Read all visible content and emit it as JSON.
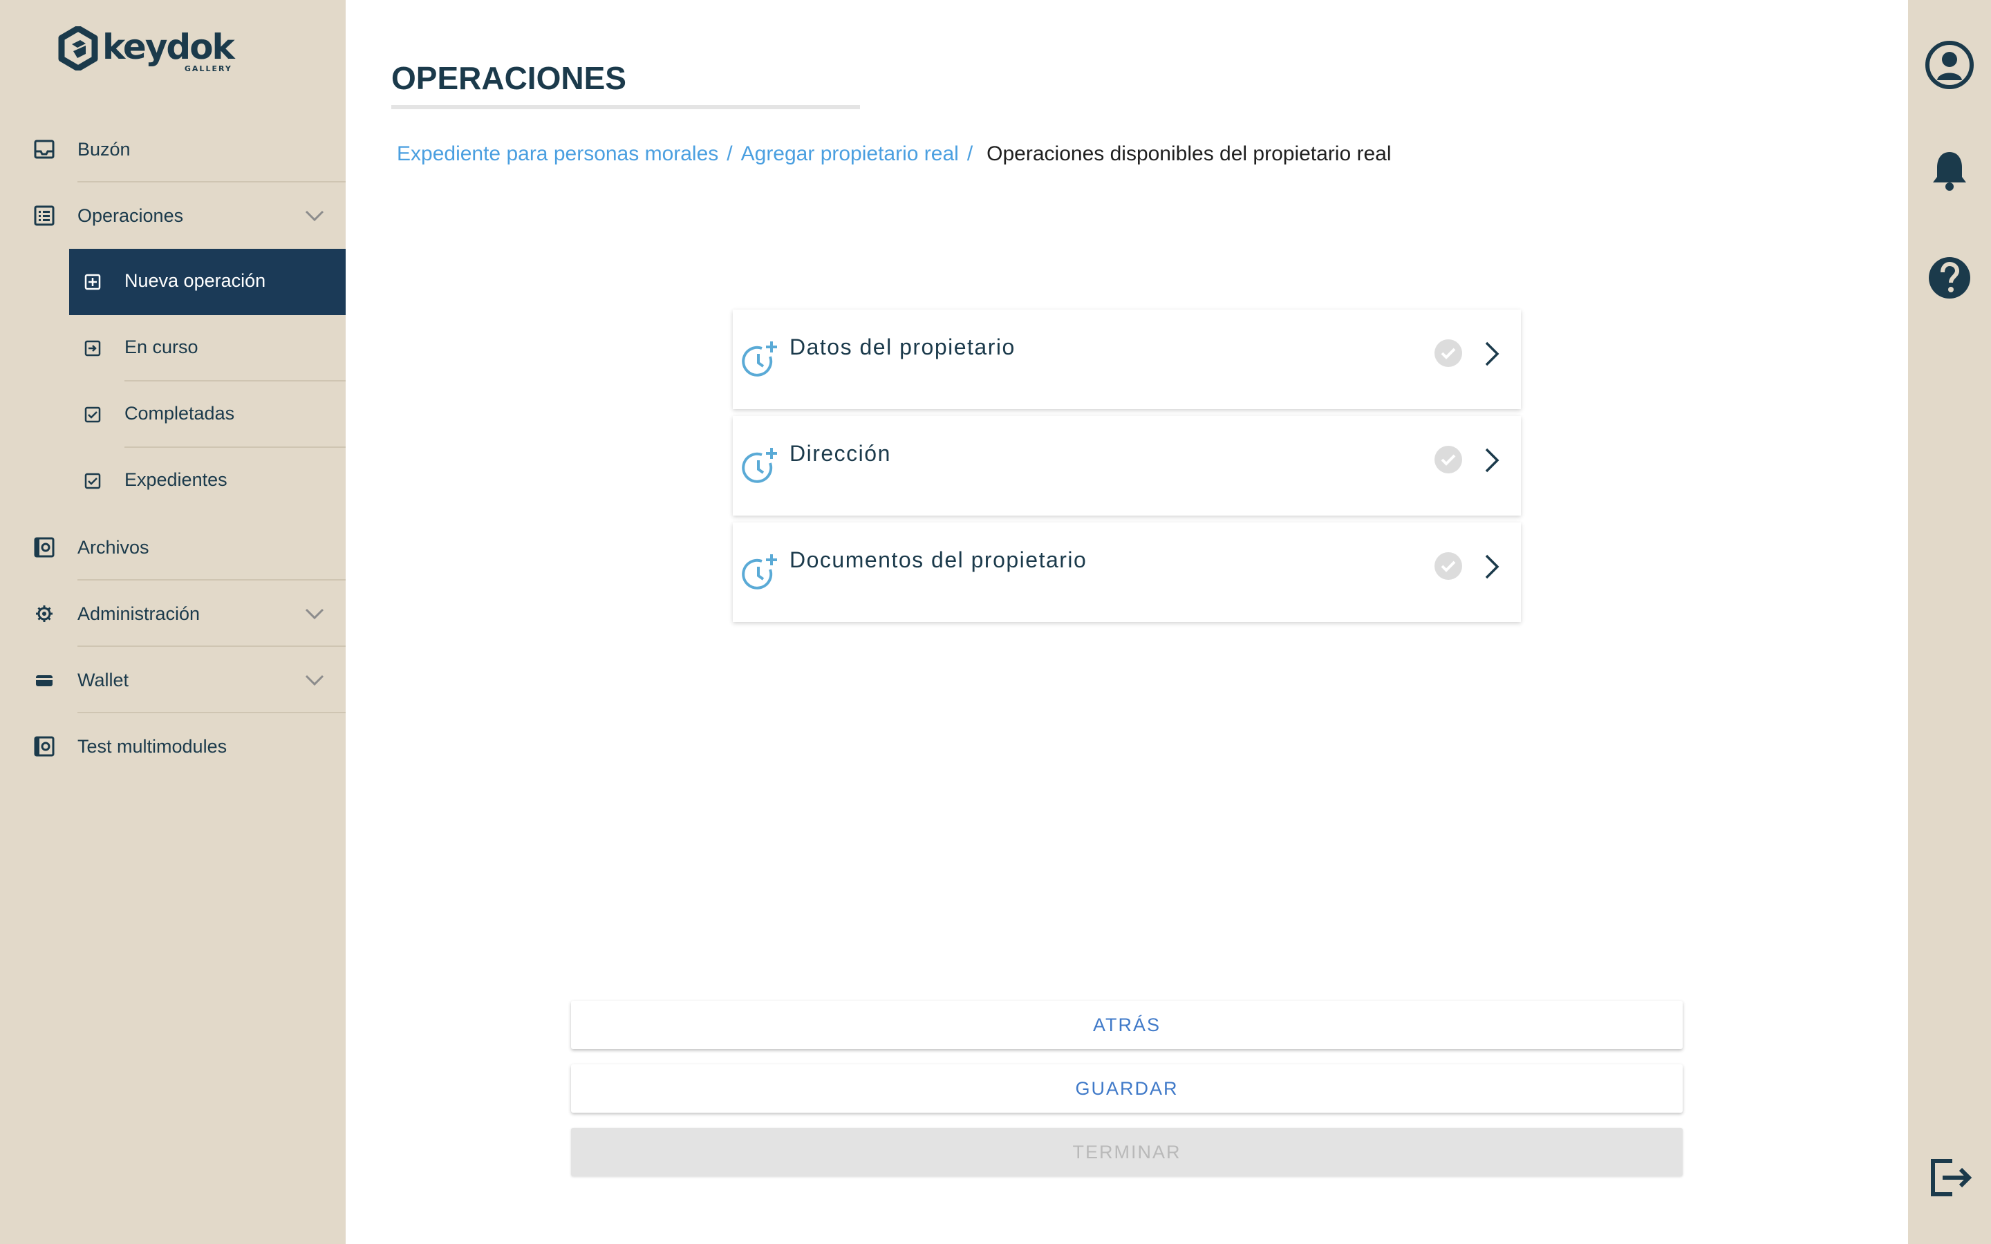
{
  "brand": {
    "logo_text": "keydok",
    "logo_sub": "GALLERY"
  },
  "sidebar": {
    "items": [
      {
        "label": "Buzón",
        "icon": "inbox-icon"
      },
      {
        "label": "Operaciones",
        "icon": "list-icon",
        "expanded": true
      },
      {
        "label": "Archivos",
        "icon": "archive-icon"
      },
      {
        "label": "Administración",
        "icon": "gear-icon"
      },
      {
        "label": "Wallet",
        "icon": "wallet-icon"
      },
      {
        "label": "Test multimodules",
        "icon": "module-icon"
      }
    ],
    "operaciones_sub": [
      {
        "label": "Nueva operación",
        "icon": "plus-box-icon",
        "active": true
      },
      {
        "label": "En curso",
        "icon": "arrow-box-icon"
      },
      {
        "label": "Completadas",
        "icon": "check-box-icon"
      },
      {
        "label": "Expedientes",
        "icon": "check-box-icon"
      }
    ]
  },
  "main": {
    "title": "OPERACIONES",
    "breadcrumb": {
      "link1": "Expediente para personas morales",
      "link2": "Agregar propietario real",
      "separator": "/",
      "current": "Operaciones disponibles del propietario real"
    },
    "operations": [
      {
        "label": "Datos del propietario",
        "status": "pending"
      },
      {
        "label": "Dirección",
        "status": "pending"
      },
      {
        "label": "Documentos del propietario",
        "status": "pending"
      }
    ],
    "buttons": {
      "back": "ATRÁS",
      "save": "GUARDAR",
      "finish": "TERMINAR"
    }
  },
  "colors": {
    "sidebar_bg": "#e2d9c9",
    "primary_dark": "#1b3a57",
    "link_blue": "#4a9fe0",
    "icon_blue": "#5aaad6",
    "button_text": "#3f79c8"
  },
  "rightbar": {
    "icons": [
      "user-avatar-icon",
      "bell-icon",
      "help-icon",
      "logout-icon"
    ]
  }
}
